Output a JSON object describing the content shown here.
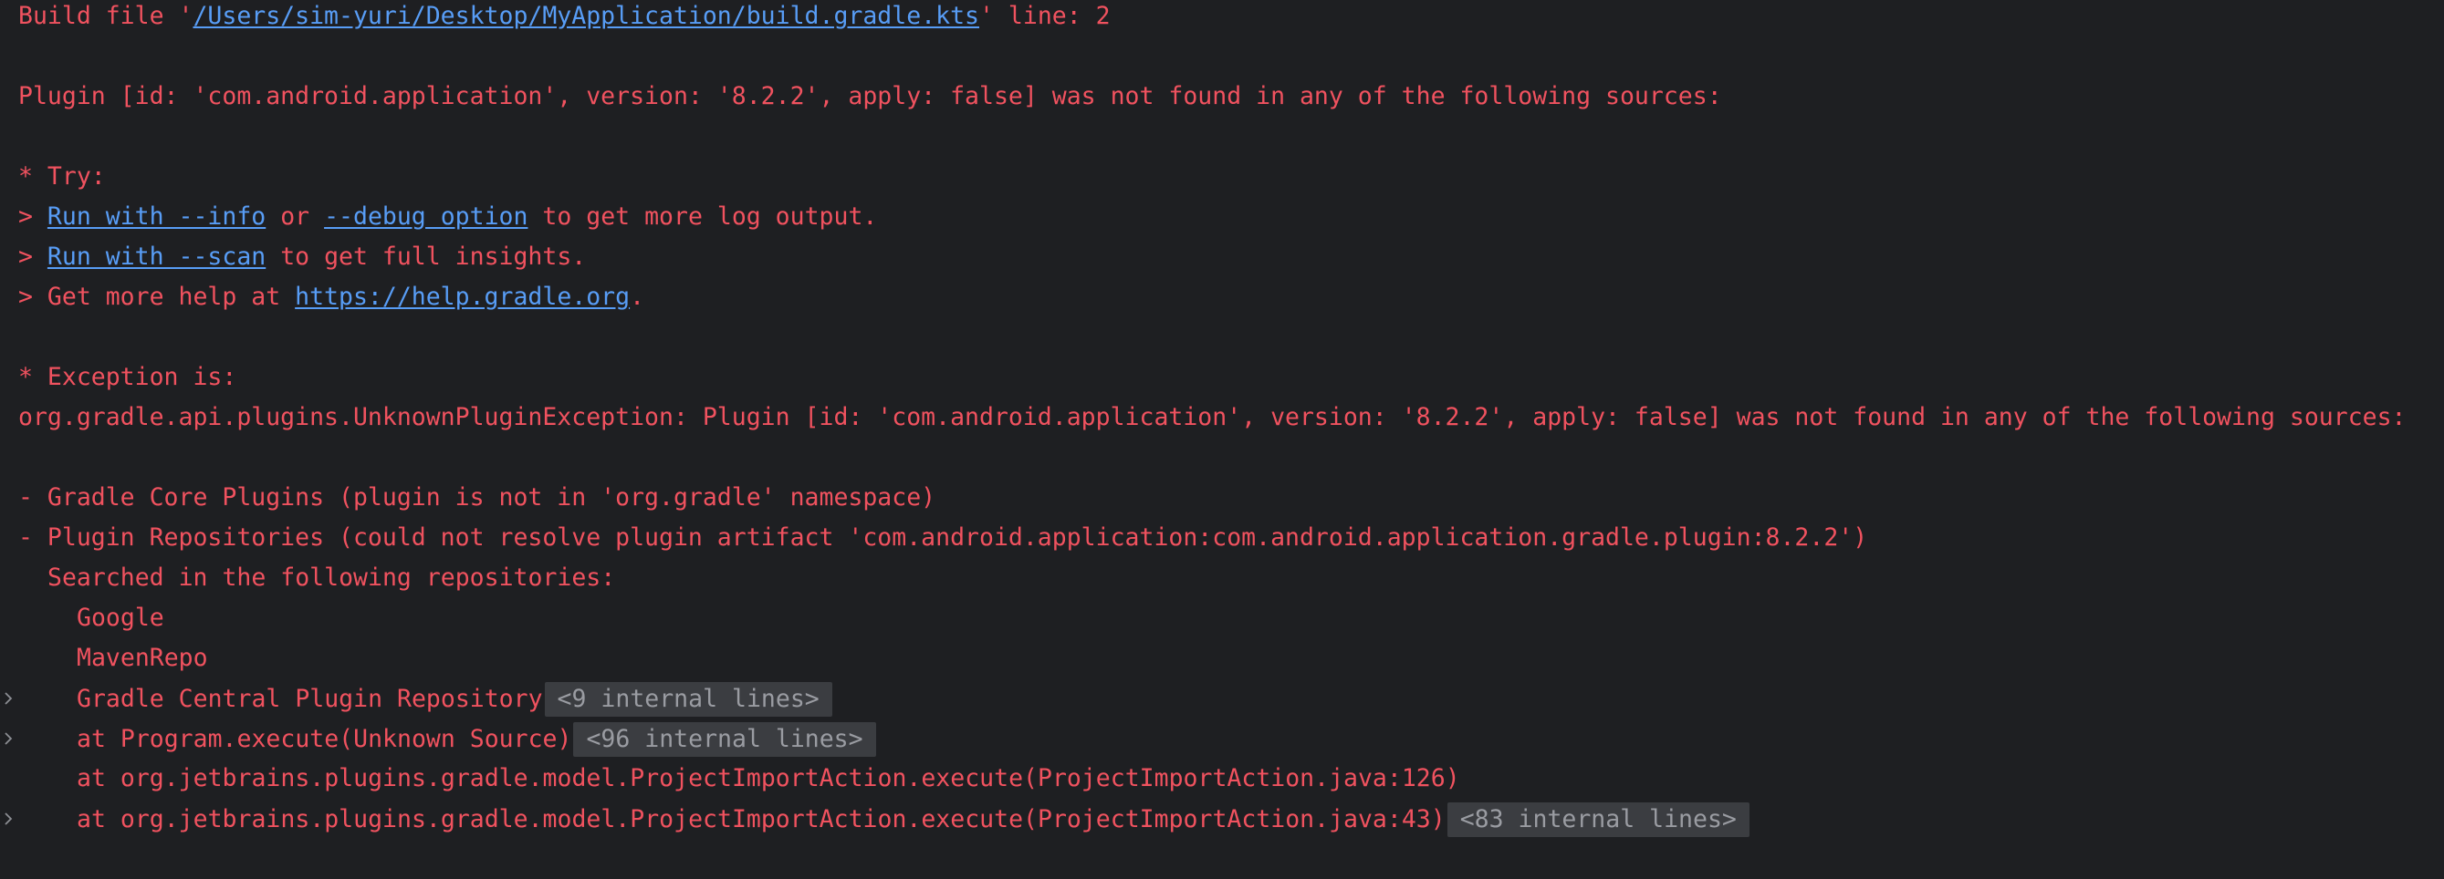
{
  "colors": {
    "background": "#1e1f22",
    "error_text": "#f0525f",
    "link": "#589df6",
    "badge_bg": "#3b3d41",
    "badge_text": "#9a9ca2",
    "chevron": "#8c8e94"
  },
  "build_file": {
    "prefix": "Build file '",
    "path": "/Users/sim-yuri/Desktop/MyApplication/build.gradle.kts",
    "suffix": "' line: 2"
  },
  "plugin_error": "Plugin [id: 'com.android.application', version: '8.2.2', apply: false] was not found in any of the following sources:",
  "try": {
    "heading": "* Try:",
    "prompt": "> ",
    "line1": {
      "link1": "Run with --info",
      "middle": " or ",
      "link2": "--debug option",
      "suffix": " to get more log output."
    },
    "line2": {
      "link": "Run with --scan",
      "suffix": " to get full insights."
    },
    "line3": {
      "prefix": "> Get more help at ",
      "link": "https://help.gradle.org",
      "suffix": "."
    }
  },
  "exception": {
    "heading": "* Exception is:",
    "message": "org.gradle.api.plugins.UnknownPluginException: Plugin [id: 'com.android.application', version: '8.2.2', apply: false] was not found in any of the following sources:"
  },
  "sources": {
    "core_plugins": "- Gradle Core Plugins (plugin is not in 'org.gradle' namespace)",
    "plugin_repos": "- Plugin Repositories (could not resolve plugin artifact 'com.android.application:com.android.application.gradle.plugin:8.2.2')",
    "searched": "Searched in the following repositories:",
    "repo_google": "Google",
    "repo_maven": "MavenRepo",
    "repo_central": "Gradle Central Plugin Repository",
    "repo_central_badge": "<9 internal lines>"
  },
  "stack": [
    {
      "text": "at Program.execute(Unknown Source)",
      "badge": "<96 internal lines>"
    },
    {
      "text": "at org.jetbrains.plugins.gradle.model.ProjectImportAction.execute(ProjectImportAction.java:126)"
    },
    {
      "text": "at org.jetbrains.plugins.gradle.model.ProjectImportAction.execute(ProjectImportAction.java:43)",
      "badge": "<83 internal lines>"
    }
  ]
}
